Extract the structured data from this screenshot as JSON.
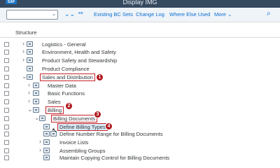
{
  "window": {
    "title": "Display IMG",
    "logo": "SAP"
  },
  "toolbar": {
    "command_value": "",
    "dropdown_glyph": "⌄",
    "expand_icon": "double-chevron-down-icon",
    "expand_glyph": "⌄⌄",
    "collapse_icon": "collapse-subtree-icon",
    "collapse_glyph": "•≡",
    "existing_bc_sets": "Existing BC Sets",
    "change_log": "Change Log",
    "where_else_used": "Where Else Used",
    "more": "More ⌄",
    "search_icon": "search-icon",
    "search_glyph": "⌕"
  },
  "structure": {
    "header": "Structure"
  },
  "tree": [
    {
      "label": "Logistics - General",
      "twist": "›"
    },
    {
      "label": "Environment, Health and Safety",
      "twist": "›"
    },
    {
      "label": "Product Safety and Stewardship",
      "twist": "›"
    },
    {
      "label": "Product Compliance",
      "twist": ""
    },
    {
      "label": "Sales and Distribution",
      "twist": "⌄",
      "badge": "1"
    },
    {
      "label": "Master Data",
      "twist": "›"
    },
    {
      "label": "Basic Functions",
      "twist": "›"
    },
    {
      "label": "Sales",
      "twist": "›"
    },
    {
      "label": "Billing",
      "twist": "⌄",
      "badge": "2"
    },
    {
      "label": "Billing Documents",
      "twist": "⌄",
      "badge": "3"
    },
    {
      "label": "Define Billing Types",
      "twist": "›",
      "badge": "4"
    },
    {
      "label": "Define Number Range for Billing Documents",
      "twist": ""
    },
    {
      "label": "Invoice Lists",
      "twist": "›"
    },
    {
      "label": "Assembling Groups",
      "twist": "›"
    },
    {
      "label": "Maintain Copying Control for Billing Documents",
      "twist": ""
    }
  ]
}
